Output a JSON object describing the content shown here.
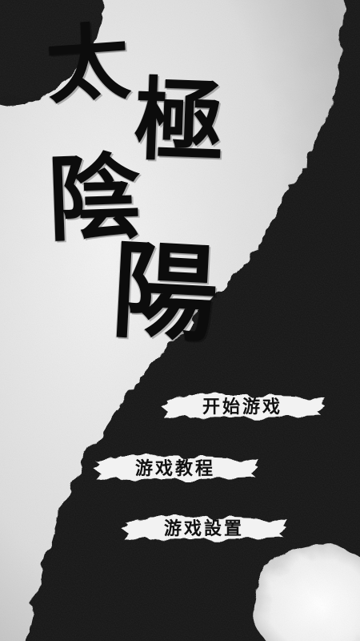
{
  "title": {
    "chars": [
      "太",
      "極",
      "陰",
      "陽"
    ]
  },
  "menu": {
    "start_label": "开始游戏",
    "tutorial_label": "游戏教程",
    "settings_label": "游戏設置"
  },
  "colors": {
    "paper": "#e6e6e6",
    "ink": "#121212",
    "brush": "#f2f2f2"
  }
}
